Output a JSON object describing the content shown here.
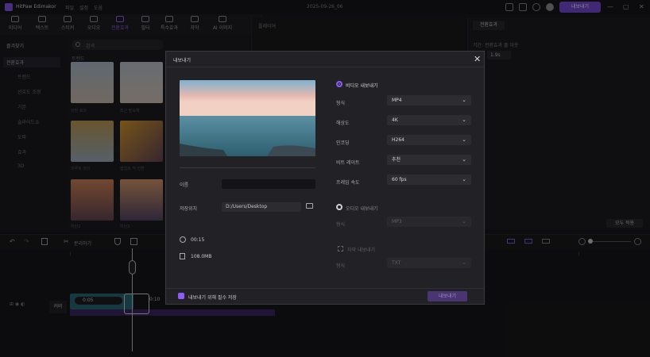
{
  "app": {
    "title": "HitPaw Edimakor",
    "menu": [
      "파일",
      "설정",
      "도움"
    ],
    "date": "2025-09-26_06",
    "export_label": "내보내기"
  },
  "toolbar": {
    "tools": [
      "미디어",
      "텍스트",
      "스티커",
      "오디오",
      "전환효과",
      "필터",
      "특수효과",
      "자막",
      "AI 이미지"
    ],
    "active_index": 4
  },
  "sidebar": {
    "items": [
      "즐겨찾기",
      "전환효과",
      "트렌드",
      "선호도 조정",
      "기본",
      "슬라이드쇼",
      "도파",
      "효과",
      "3D"
    ]
  },
  "media": {
    "search_placeholder": "검색",
    "section_label": "트렌드",
    "thumbs": [
      "전환 효과",
      "최근 필요해",
      "파루트 정의",
      "팝업트 적 전환",
      "하단2",
      "하단3"
    ]
  },
  "preview": {
    "label": "플레이어"
  },
  "right_panel": {
    "tab": "전환효과",
    "duration_label": "기간: 전환효과 줄 아웃",
    "duration_value": "1.9s",
    "apply_all": "모두 적용"
  },
  "timeline": {
    "split_label": "분리하기",
    "clip_time": "0:05",
    "track_label": "커버",
    "clip_time_2": "0:10"
  },
  "dialog": {
    "title": "내보내기",
    "close_glyph": "✕",
    "name_label": "이름",
    "name_value": "",
    "path_label": "저장위치",
    "path_value": "D:/Users/Desktop",
    "duration": "00:15",
    "file_size": "108.0MB",
    "video_export_label": "비디오 내보내기",
    "audio_export_label": "오디오 내보내기",
    "rows": [
      {
        "label": "형식",
        "value": "MP4"
      },
      {
        "label": "해상도",
        "value": "4K"
      },
      {
        "label": "인코딩",
        "value": "H264"
      },
      {
        "label": "비트 레이트",
        "value": "추천"
      },
      {
        "label": "프레임 속도",
        "value": "60  fps"
      }
    ],
    "audio_format_label": "형식",
    "audio_format_value": "MP3",
    "subtitle_label": "자막 내보내기",
    "subtitle_format_label": "형식",
    "subtitle_format_value": "TXT",
    "save_settings_label": "내보내기 위해 필수 저장",
    "export_button": "내보내기"
  }
}
